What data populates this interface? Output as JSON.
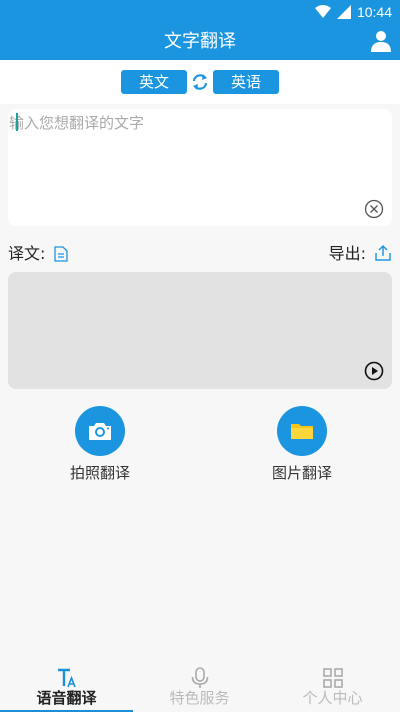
{
  "status_bar": {
    "time": "10:44"
  },
  "header": {
    "title": "文字翻译"
  },
  "languages": {
    "source": "英文",
    "target": "英语"
  },
  "input": {
    "placeholder": "输入您想翻译的文字",
    "value": ""
  },
  "result": {
    "label": "译文:",
    "export_label": "导出:",
    "text": ""
  },
  "features": [
    {
      "label": "拍照翻译",
      "icon": "camera-icon"
    },
    {
      "label": "图片翻译",
      "icon": "folder-icon"
    }
  ],
  "bottom_nav": {
    "items": [
      {
        "label": "语音翻译",
        "icon": "text-translate-icon",
        "active": true
      },
      {
        "label": "特色服务",
        "icon": "microphone-icon",
        "active": false
      },
      {
        "label": "个人中心",
        "icon": "grid-icon",
        "active": false
      }
    ]
  },
  "colors": {
    "primary": "#1b95e0",
    "folder": "#f5c518",
    "output_bg": "#e2e2e2"
  }
}
